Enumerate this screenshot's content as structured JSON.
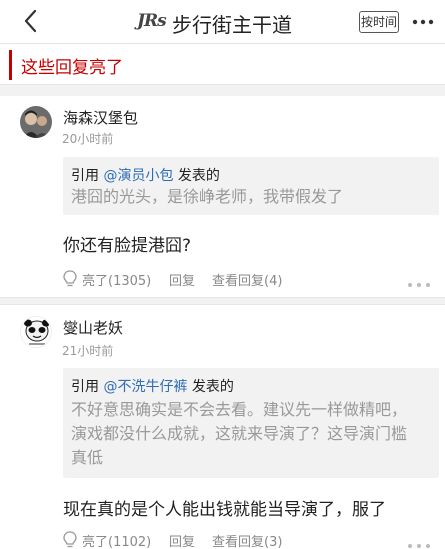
{
  "header": {
    "logo_text": "JRs",
    "title": "步行街主干道",
    "sort_label": "按时间"
  },
  "section": {
    "title": "这些回复亮了"
  },
  "posts": [
    {
      "username": "海森汉堡包",
      "time": "20小时前",
      "quote_prefix": "引用 ",
      "quote_user": "@演员小包",
      "quote_suffix": " 发表的",
      "quote_lines": [
        "港囧的光头，是徐峥老师，我带假发了"
      ],
      "reply": "你还有脸提港囧?",
      "like_label": "亮了(1305)",
      "reply_label": "回复",
      "view_label": "查看回复(4)"
    },
    {
      "username": "燮山老妖",
      "time": "21小时前",
      "quote_prefix": "引用 ",
      "quote_user": "@不洗牛仔裤",
      "quote_suffix": " 发表的",
      "quote_lines": [
        "不好意思确实是不会去看。建议先一样做精吧，",
        "演戏都没什么成就，这就来导演了？这导演门槛",
        "真低"
      ],
      "reply": "现在真的是个人能出钱就能当导演了，服了",
      "like_label": "亮了(1102)",
      "reply_label": "回复",
      "view_label": "查看回复(3)"
    }
  ],
  "colors": {
    "accent_red": "#c40000",
    "quote_user_blue": "#2c6cb8",
    "muted_gray": "#999999",
    "quote_bg": "#f2f2f2"
  },
  "icons": [
    "back-arrow-icon",
    "more-icon",
    "avatar-photo",
    "avatar-panda-meme",
    "bulb-icon",
    "more-dots-icon"
  ]
}
